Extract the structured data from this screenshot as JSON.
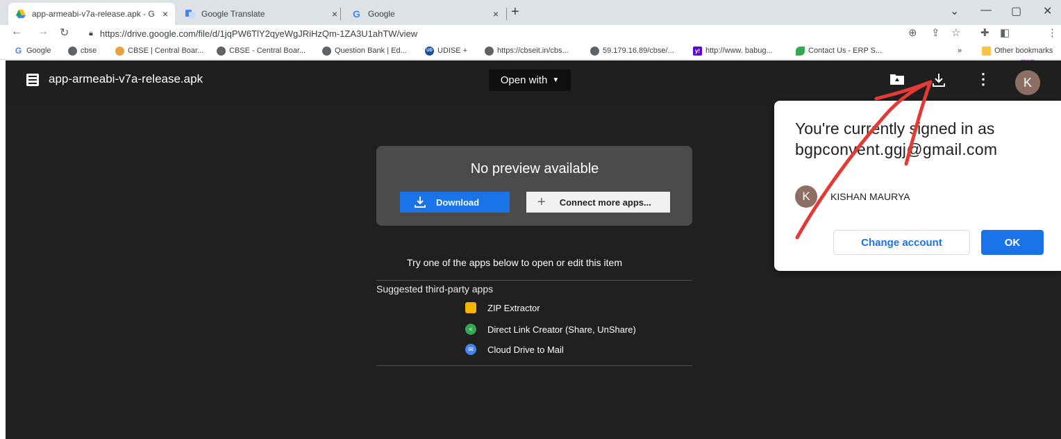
{
  "browser": {
    "tabs": [
      {
        "title": "app-armeabi-v7a-release.apk - G",
        "icon": "google-drive-icon",
        "active": true
      },
      {
        "title": "Google Translate",
        "icon": "google-translate-icon",
        "active": false
      },
      {
        "title": "Google",
        "icon": "google-g-icon",
        "active": false
      }
    ],
    "tab_close_glyph": "×",
    "new_tab_glyph": "+",
    "url": "https://drive.google.com/file/d/1jqPW6TlY2qyeWgJRiHzQm-1ZA3U1ahTW/view",
    "profile_initial": "K"
  },
  "bookmarks": {
    "items": [
      {
        "label": "Google",
        "icon": "google-g-icon"
      },
      {
        "label": "cbse",
        "icon": "globe-icon"
      },
      {
        "label": "CBSE | Central Boar...",
        "icon": "cbse-logo-icon"
      },
      {
        "label": "CBSE - Central Boar...",
        "icon": "globe-icon"
      },
      {
        "label": "Question Bank | Ed...",
        "icon": "globe-icon"
      },
      {
        "label": "UDISE +",
        "icon": "udise-icon"
      },
      {
        "label": "https://cbseit.in/cbs...",
        "icon": "globe-icon"
      },
      {
        "label": "59.179.16.89/cbse/...",
        "icon": "globe-icon"
      },
      {
        "label": "http://www. babug...",
        "icon": "yahoo-icon"
      },
      {
        "label": "Contact Us - ERP S...",
        "icon": "erp-leaf-icon"
      }
    ],
    "overflow": "»",
    "other": "Other bookmarks"
  },
  "viewer": {
    "file_name": "app-armeabi-v7a-release.apk",
    "open_with": "Open with",
    "user_initial": "K",
    "no_preview": "No preview available",
    "download_label": "Download",
    "connect_label": "Connect more apps...",
    "try_text": "Try one of the apps below to open or edit this item",
    "suggested_label": "Suggested third-party apps",
    "apps": [
      {
        "name": "ZIP Extractor",
        "icon": "zip-extractor-icon",
        "color": "#f4b400"
      },
      {
        "name": "Direct Link Creator (Share, UnShare)",
        "icon": "share-icon",
        "color": "#34a853"
      },
      {
        "name": "Cloud Drive to Mail",
        "icon": "mail-icon",
        "color": "#4285f4"
      }
    ]
  },
  "dialog": {
    "message_prefix": "You're currently signed in as",
    "email": "bgpconvent.ggj@gmail.com",
    "account_initial": "K",
    "account_name": "KISHAN MAURYA",
    "change_account": "Change account",
    "ok": "OK"
  },
  "colors": {
    "accent": "#1a73e8",
    "annotation": "#e53935",
    "viewer_bg": "#202020"
  }
}
